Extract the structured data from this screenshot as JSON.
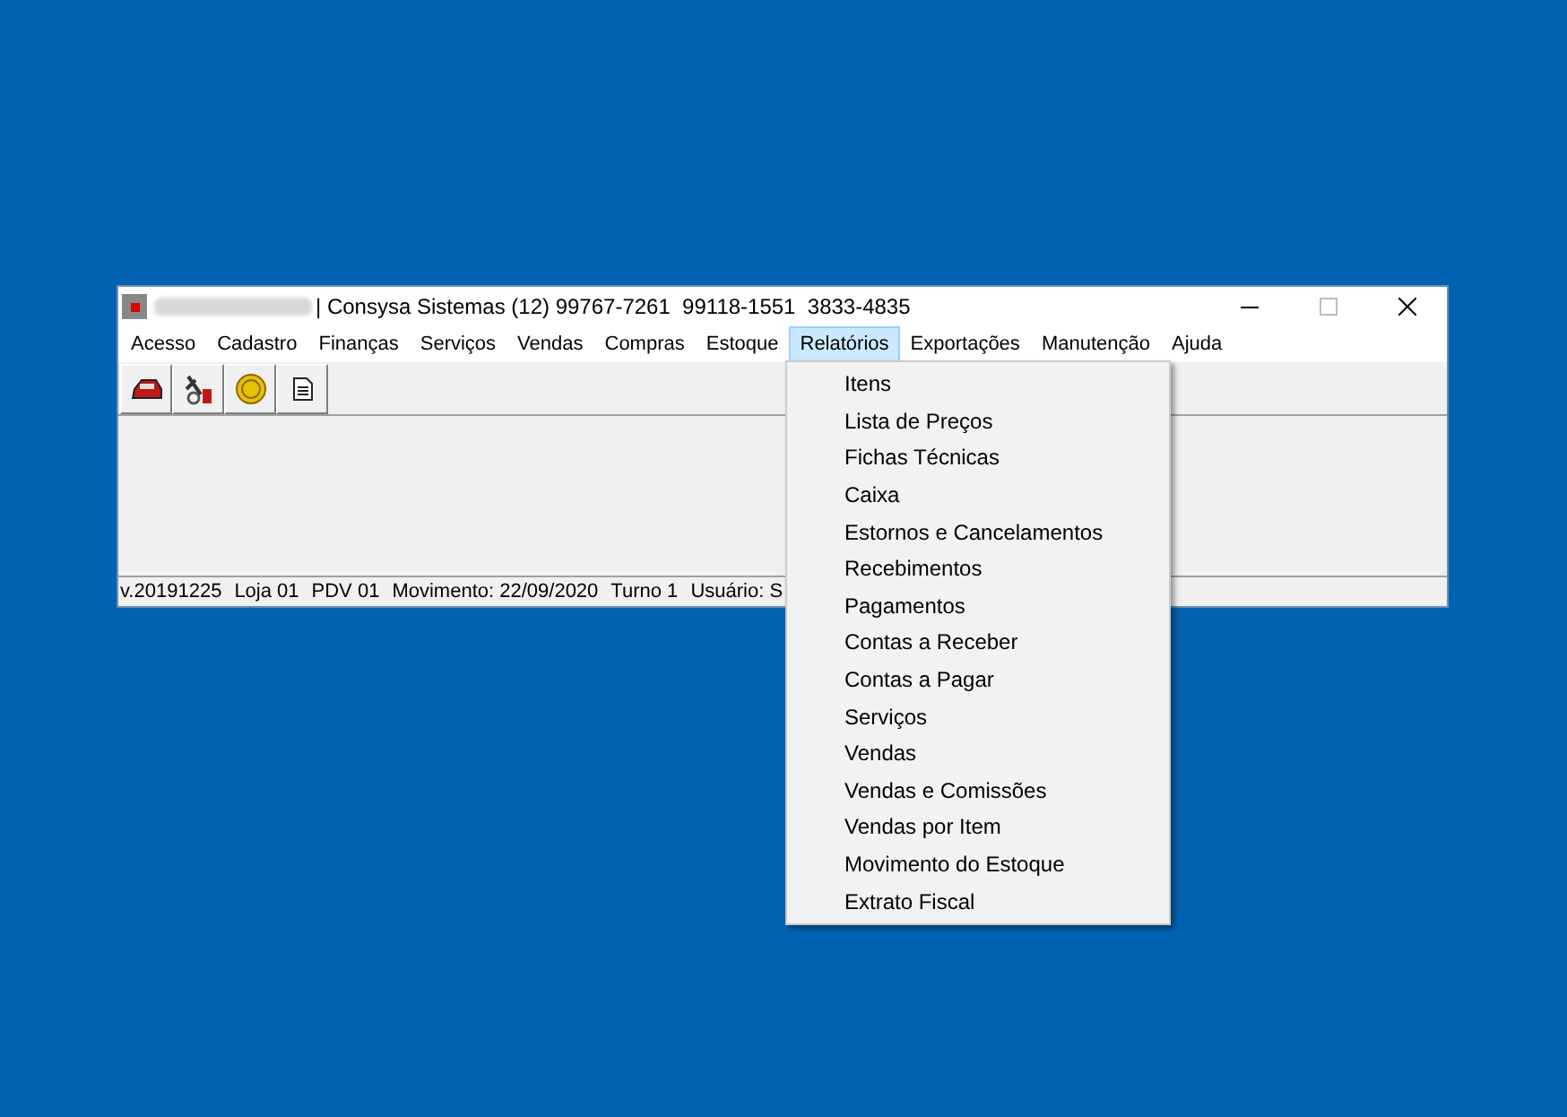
{
  "window": {
    "title": "| Consysa Sistemas (12) 99767-7261  99118-1551  3833-4835"
  },
  "menu": [
    {
      "label": "Acesso",
      "selected": false
    },
    {
      "label": "Cadastro",
      "selected": false
    },
    {
      "label": "Finanças",
      "selected": false
    },
    {
      "label": "Serviços",
      "selected": false
    },
    {
      "label": "Vendas",
      "selected": false
    },
    {
      "label": "Compras",
      "selected": false
    },
    {
      "label": "Estoque",
      "selected": false
    },
    {
      "label": "Relatórios",
      "selected": true
    },
    {
      "label": "Exportações",
      "selected": false
    },
    {
      "label": "Manutenção",
      "selected": false
    },
    {
      "label": "Ajuda",
      "selected": false
    }
  ],
  "toolbar": [
    {
      "kind": "printer"
    },
    {
      "kind": "tools"
    },
    {
      "kind": "coin"
    },
    {
      "kind": "document"
    }
  ],
  "dropdown": [
    "Itens",
    "Lista de Preços",
    "Fichas Técnicas",
    "Caixa",
    "Estornos e Cancelamentos",
    "Recebimentos",
    "Pagamentos",
    "Contas a Receber",
    "Contas a Pagar",
    "Serviços",
    "Vendas",
    "Vendas e Comissões",
    "Vendas por Item",
    "Movimento do Estoque",
    "Extrato Fiscal"
  ],
  "status_bar": [
    "v.20191225",
    "Loja 01",
    "PDV 01",
    "Movimento: 22/09/2020",
    "Turno 1",
    "Usuário: S"
  ]
}
